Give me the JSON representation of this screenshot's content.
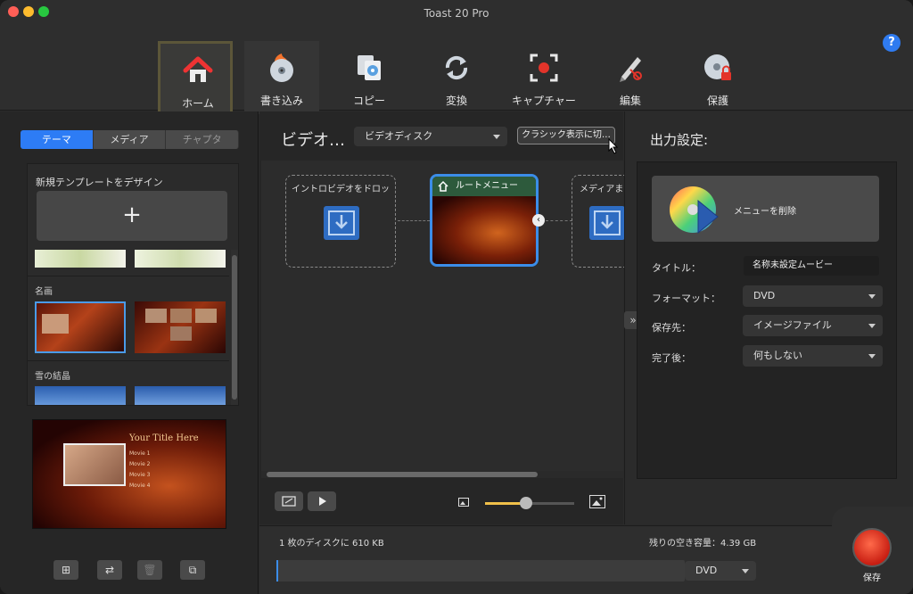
{
  "window": {
    "title": "Toast 20 Pro"
  },
  "toolbar": {
    "help": "?",
    "items": [
      {
        "label": "ホーム",
        "icon": "home-icon"
      },
      {
        "label": "書き込み",
        "icon": "burn-disc-icon"
      },
      {
        "label": "コピー",
        "icon": "copy-disc-icon"
      },
      {
        "label": "変換",
        "icon": "convert-icon"
      },
      {
        "label": "キャプチャー",
        "icon": "capture-icon"
      },
      {
        "label": "編集",
        "icon": "edit-icon"
      },
      {
        "label": "保護",
        "icon": "protect-disc-icon"
      }
    ]
  },
  "left": {
    "tabs": [
      "テーマ",
      "メディア",
      "チャプタ"
    ],
    "new_template_label": "新規テンプレートをデザイン",
    "plus": "+",
    "sections": [
      "名画",
      "雪の結晶"
    ],
    "preview": {
      "title": "Your Title Here",
      "movies": [
        "Movie 1",
        "Movie 2",
        "Movie 3",
        "Movie 4"
      ]
    }
  },
  "center": {
    "title": "ビデオ…",
    "disc_type": "ビデオディスク",
    "classic_button": "クラシック表示に切…",
    "nodes": {
      "intro": "イントロビデオをドロッ",
      "root": "ルートメニュー",
      "media": "メディアま"
    }
  },
  "right": {
    "title": "出力設定:",
    "remove_menu": "メニューを削除",
    "fields": {
      "title_label": "タイトル：",
      "title_value": "名称未設定ムービー",
      "format_label": "フォーマット：",
      "format_value": "DVD",
      "dest_label": "保存先：",
      "dest_value": "イメージファイル",
      "after_label": "完了後：",
      "after_value": "何もしない"
    },
    "collapse": "»"
  },
  "bottom": {
    "disc_info": "1 枚のディスクに 610 KB",
    "free_info": "残りの空き容量：4.39 GB",
    "disc_select": "DVD",
    "save_label": "保存",
    "capacity_used_fraction": 0.004
  }
}
